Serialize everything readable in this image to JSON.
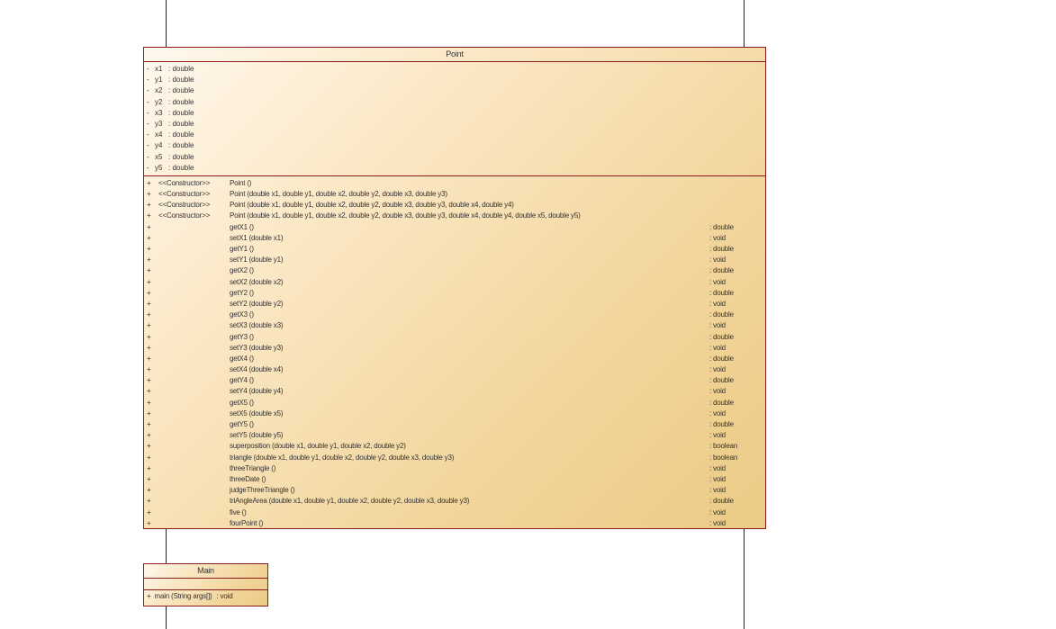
{
  "point_class": {
    "name": "Point",
    "attributes": [
      {
        "vis": "-",
        "name": "x1",
        "type": ": double"
      },
      {
        "vis": "-",
        "name": "y1",
        "type": ": double"
      },
      {
        "vis": "-",
        "name": "x2",
        "type": ": double"
      },
      {
        "vis": "-",
        "name": "y2",
        "type": ": double"
      },
      {
        "vis": "-",
        "name": "x3",
        "type": ": double"
      },
      {
        "vis": "-",
        "name": "y3",
        "type": ": double"
      },
      {
        "vis": "-",
        "name": "x4",
        "type": ": double"
      },
      {
        "vis": "-",
        "name": "y4",
        "type": ": double"
      },
      {
        "vis": "-",
        "name": "x5",
        "type": ": double"
      },
      {
        "vis": "-",
        "name": "y5",
        "type": ": double"
      }
    ],
    "operations": [
      {
        "vis": "+",
        "stereo": "<<Constructor>>",
        "sig": "Point ()",
        "ret": ""
      },
      {
        "vis": "+",
        "stereo": "<<Constructor>>",
        "sig": "Point (double x1, double y1, double x2, double y2, double x3, double y3)",
        "ret": ""
      },
      {
        "vis": "+",
        "stereo": "<<Constructor>>",
        "sig": "Point (double x1, double y1, double x2, double y2, double x3, double y3, double x4, double y4)",
        "ret": ""
      },
      {
        "vis": "+",
        "stereo": "<<Constructor>>",
        "sig": "Point (double x1, double y1, double x2, double y2, double x3, double y3, double x4, double y4, double x5, double y5)",
        "ret": ""
      },
      {
        "vis": "+",
        "stereo": "",
        "sig": "getX1 ()",
        "ret": ": double"
      },
      {
        "vis": "+",
        "stereo": "",
        "sig": "setX1 (double x1)",
        "ret": ": void"
      },
      {
        "vis": "+",
        "stereo": "",
        "sig": "getY1 ()",
        "ret": ": double"
      },
      {
        "vis": "+",
        "stereo": "",
        "sig": "setY1 (double y1)",
        "ret": ": void"
      },
      {
        "vis": "+",
        "stereo": "",
        "sig": "getX2 ()",
        "ret": ": double"
      },
      {
        "vis": "+",
        "stereo": "",
        "sig": "setX2 (double x2)",
        "ret": ": void"
      },
      {
        "vis": "+",
        "stereo": "",
        "sig": "getY2 ()",
        "ret": ": double"
      },
      {
        "vis": "+",
        "stereo": "",
        "sig": "setY2 (double y2)",
        "ret": ": void"
      },
      {
        "vis": "+",
        "stereo": "",
        "sig": "getX3 ()",
        "ret": ": double"
      },
      {
        "vis": "+",
        "stereo": "",
        "sig": "setX3 (double x3)",
        "ret": ": void"
      },
      {
        "vis": "+",
        "stereo": "",
        "sig": "getY3 ()",
        "ret": ": double"
      },
      {
        "vis": "+",
        "stereo": "",
        "sig": "setY3 (double y3)",
        "ret": ": void"
      },
      {
        "vis": "+",
        "stereo": "",
        "sig": "getX4 ()",
        "ret": ": double"
      },
      {
        "vis": "+",
        "stereo": "",
        "sig": "setX4 (double x4)",
        "ret": ": void"
      },
      {
        "vis": "+",
        "stereo": "",
        "sig": "getY4 ()",
        "ret": ": double"
      },
      {
        "vis": "+",
        "stereo": "",
        "sig": "setY4 (double y4)",
        "ret": ": void"
      },
      {
        "vis": "+",
        "stereo": "",
        "sig": "getX5 ()",
        "ret": ": double"
      },
      {
        "vis": "+",
        "stereo": "",
        "sig": "setX5 (double x5)",
        "ret": ": void"
      },
      {
        "vis": "+",
        "stereo": "",
        "sig": "getY5 ()",
        "ret": ": double"
      },
      {
        "vis": "+",
        "stereo": "",
        "sig": "setY5 (double y5)",
        "ret": ": void"
      },
      {
        "vis": "+",
        "stereo": "",
        "sig": "superposition (double x1, double y1, double x2, double y2)",
        "ret": ": boolean"
      },
      {
        "vis": "+",
        "stereo": "",
        "sig": "triangle (double x1, double y1, double x2, double y2, double x3, double y3)",
        "ret": ": boolean"
      },
      {
        "vis": "+",
        "stereo": "",
        "sig": "threeTriangle ()",
        "ret": ": void"
      },
      {
        "vis": "+",
        "stereo": "",
        "sig": "threeDate ()",
        "ret": ": void"
      },
      {
        "vis": "+",
        "stereo": "",
        "sig": "judgeThreeTriangle ()",
        "ret": ": void"
      },
      {
        "vis": "+",
        "stereo": "",
        "sig": "triAngleArea (double x1, double y1, double x2, double y2, double x3, double y3)",
        "ret": ": double"
      },
      {
        "vis": "+",
        "stereo": "",
        "sig": "five ()",
        "ret": ": void"
      },
      {
        "vis": "+",
        "stereo": "",
        "sig": "fourPoint ()",
        "ret": ": void"
      }
    ]
  },
  "main_class": {
    "name": "Main",
    "operations": [
      {
        "vis": "+",
        "sig": "main (String args[])",
        "ret": ": void"
      }
    ]
  },
  "colors": {
    "border": "#8b1a1a",
    "fill_light": "#fff8ee",
    "fill_dark": "#eccb85",
    "line": "#222222"
  }
}
